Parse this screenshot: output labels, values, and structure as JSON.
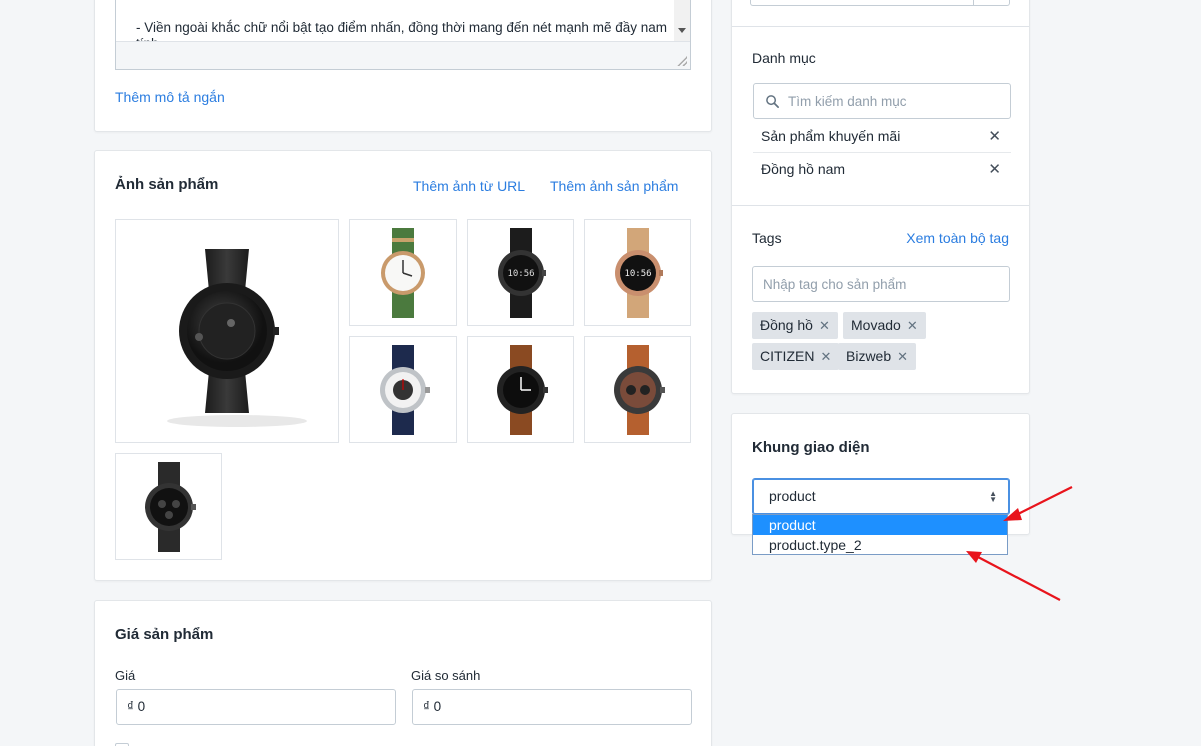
{
  "description": {
    "editor_line1": "- Viền ngoài khắc chữ nổi bật tạo điểm nhấn, đồng thời mang đến nét mạnh mẽ đầy nam",
    "editor_line2": "tính",
    "short_desc_link": "Thêm mô tả ngắn"
  },
  "images": {
    "title": "Ảnh sản phẩm",
    "add_from_url": "Thêm ảnh từ URL",
    "add_image": "Thêm ảnh sản phẩm",
    "main_time": "",
    "thumb_times": [
      "10:56",
      "10:56"
    ]
  },
  "price": {
    "title": "Giá sản phẩm",
    "price_label": "Giá",
    "price_value": "₫ 0",
    "compare_label": "Giá so sánh",
    "compare_value": "₫ 0"
  },
  "categories": {
    "title": "Danh mục",
    "search_placeholder": "Tìm kiếm danh mục",
    "items": [
      {
        "label": "Sản phẩm khuyến mãi",
        "remove": "✕"
      },
      {
        "label": "Đồng hồ nam",
        "remove": "✕"
      }
    ]
  },
  "tags": {
    "title": "Tags",
    "view_all": "Xem toàn bộ tag",
    "input_placeholder": "Nhập tag cho sản phẩm",
    "chips": [
      {
        "label": "Đồng hồ",
        "remove": "✕"
      },
      {
        "label": "Movado",
        "remove": "✕"
      },
      {
        "label": "CITIZEN",
        "remove": "✕"
      },
      {
        "label": "Bizweb",
        "remove": "✕"
      }
    ]
  },
  "template": {
    "title": "Khung giao diện",
    "selected": "product",
    "options": [
      "product",
      "product.type_2"
    ]
  },
  "colors": {
    "link": "#2b7de0",
    "annotation_arrow": "#e8141c",
    "dropdown_highlight": "#1e90ff"
  }
}
